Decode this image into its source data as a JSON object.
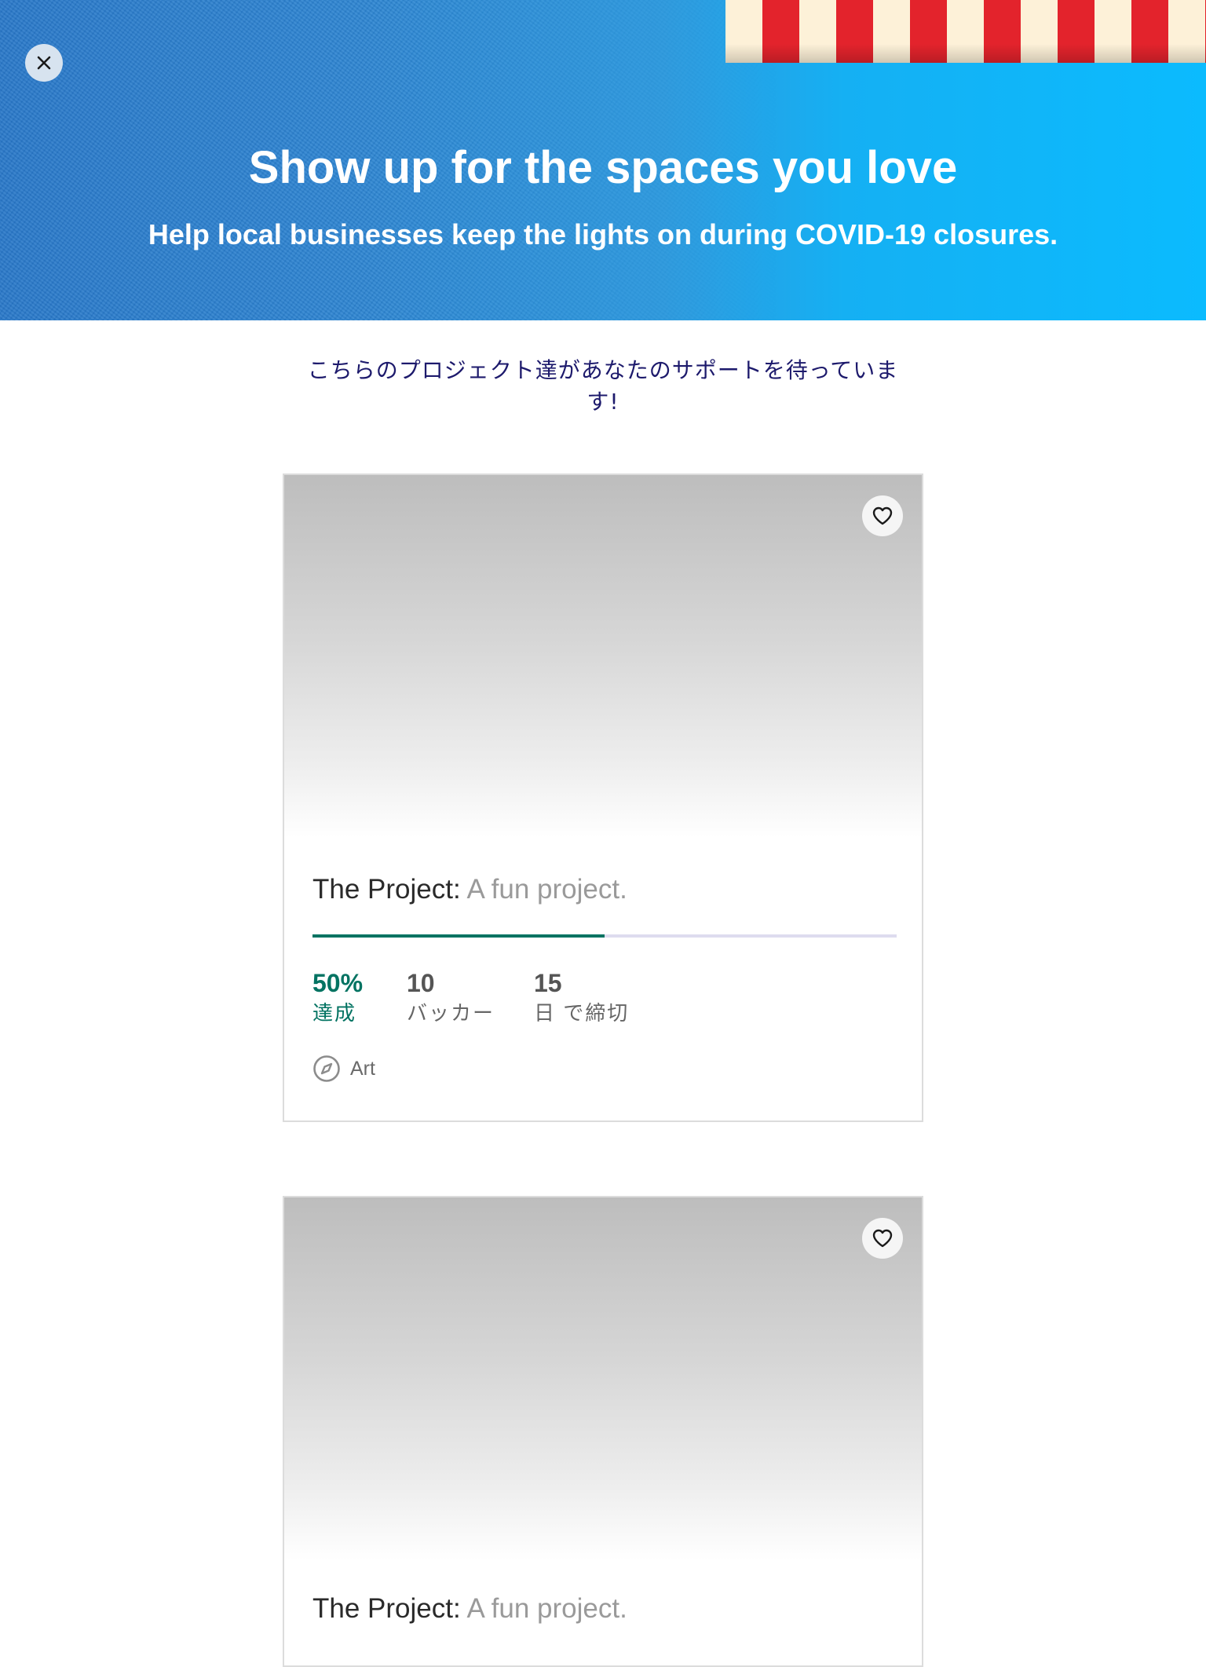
{
  "banner": {
    "title": "Show up for the spaces you love",
    "subtitle": "Help local businesses keep the lights on during COVID-19 closures.",
    "close_icon": "close-icon",
    "accent_colors": [
      "#2a79c9",
      "#0bbbfe",
      "#e3232c",
      "#fdf1d8"
    ]
  },
  "intro": {
    "text": "こちらのプロジェクト達があなたのサポートを待っています!"
  },
  "projects": [
    {
      "name": "The Project:",
      "blurb": "A fun project.",
      "percent_funded": 0.5,
      "funded_value": "50%",
      "funded_label": "達成",
      "backers_value": "10",
      "backers_label": "バッカー",
      "days_value": "15",
      "days_label": "日 で締切",
      "category": "Art",
      "category_icon": "compass-icon",
      "save_icon": "heart-icon"
    },
    {
      "name": "The Project:",
      "blurb": "A fun project.",
      "save_icon": "heart-icon"
    }
  ],
  "colors": {
    "progress_fill": "#037362",
    "progress_track": "#dedcef",
    "intro_text": "#1d1a6c"
  }
}
